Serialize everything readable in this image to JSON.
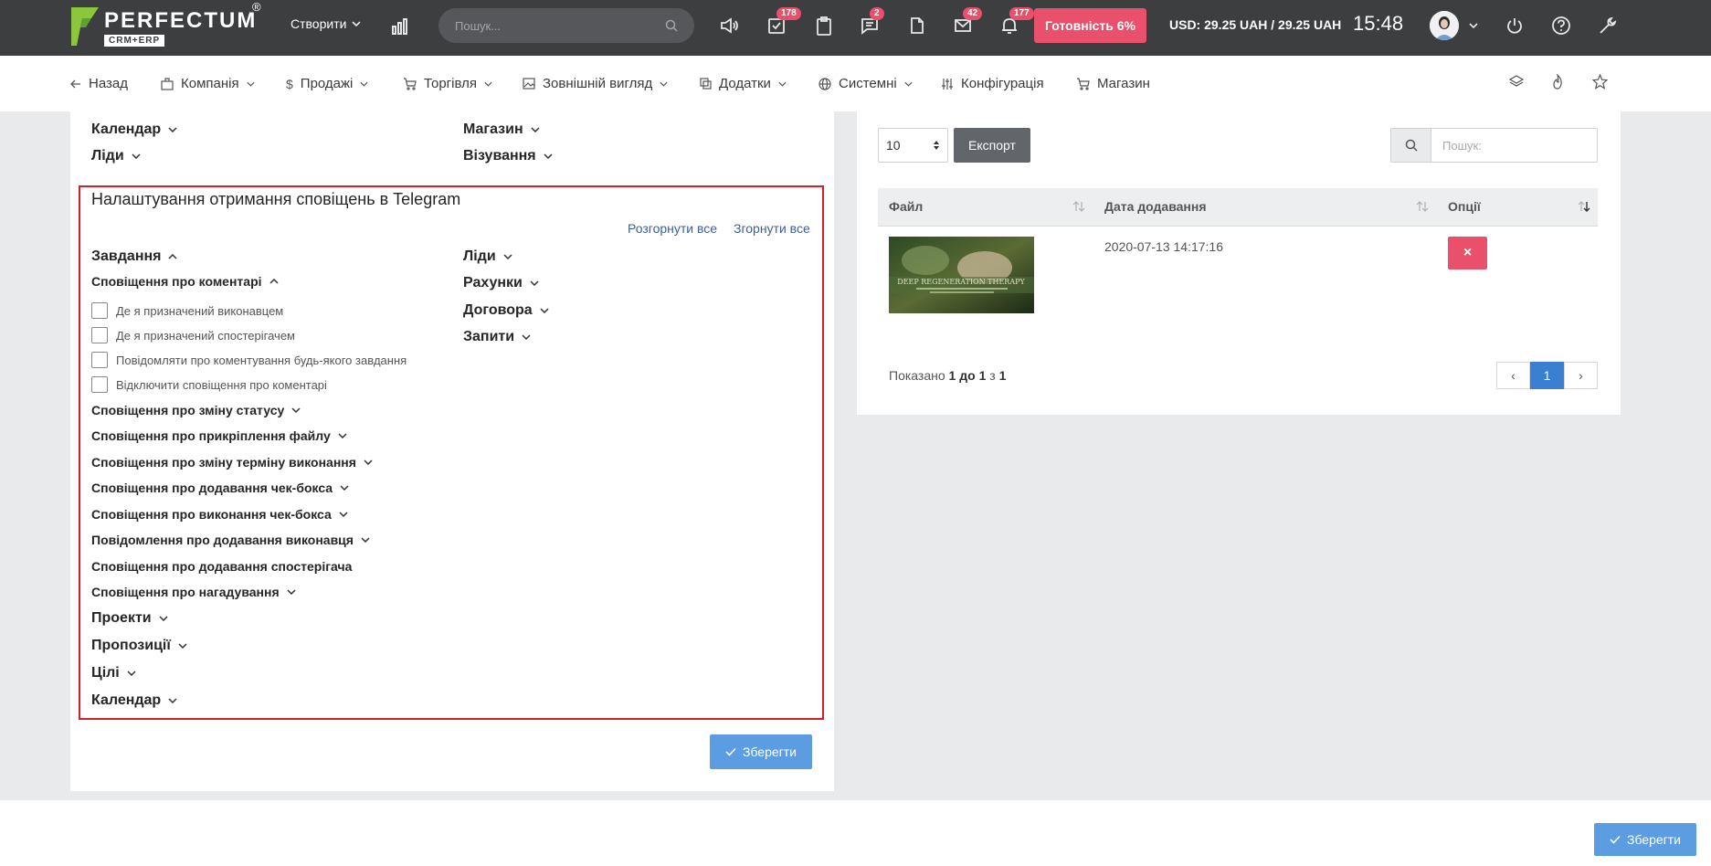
{
  "topbar": {
    "brand": "PERFECTUM",
    "brand_reg": "®",
    "brand_sub": "CRM+ERP",
    "create_label": "Створити",
    "search_placeholder": "Пошук...",
    "badges": {
      "tasks": "178",
      "chat": "2",
      "mail": "42",
      "notifications": "177"
    },
    "ready_label": "Готовність 6%",
    "rate_text": "USD: 29.25 UAH / 29.25 UAH",
    "time": "15:48"
  },
  "nav": {
    "items": [
      "Назад",
      "Компанія",
      "Продажі",
      "Торгівля",
      "Зовнішній вигляд",
      "Додатки",
      "Системні",
      "Конфігурація",
      "Магазин"
    ]
  },
  "left": {
    "top_sections": {
      "calendar": "Календар",
      "shop": "Магазин",
      "leads": "Ліди",
      "visa": "Візування"
    },
    "telegram_title": "Налаштування отримання сповіщень в Telegram",
    "expand_all": "Розгорнути все",
    "collapse_all": "Згорнути все",
    "col1": {
      "tasks": "Завдання",
      "comments": "Сповіщення про коментарі",
      "checkboxes": [
        "Де я призначений виконавцем",
        "Де я призначений спостерігачем",
        "Повідомляти про коментування будь-якого завдання",
        "Відключити сповіщення про коментарі"
      ],
      "subs": [
        "Сповіщення про зміну статусу",
        "Сповіщення про прикріплення файлу",
        "Сповіщення про зміну терміну виконання",
        "Сповіщення про додавання чек-бокса",
        "Сповіщення про виконання чек-бокса",
        "Повідомлення про додавання виконавця",
        "Сповіщення про додавання спостерігача",
        "Сповіщення про нагадування"
      ],
      "sections": [
        "Проекти",
        "Пропозиції",
        "Цілі",
        "Календар"
      ]
    },
    "col2": [
      "Ліди",
      "Рахунки",
      "Договора",
      "Запити"
    ],
    "save_label": "Зберегти"
  },
  "right": {
    "per_page": "10",
    "export_label": "Експорт",
    "search_placeholder": "Пошук:",
    "columns": [
      "Файл",
      "Дата додавання",
      "Опції"
    ],
    "rows": [
      {
        "date": "2020-07-13 14:17:16",
        "thumb_caption": "DEEP REGENERATION THERAPY"
      }
    ],
    "delete_label": "×",
    "shown": {
      "prefix": "Показано",
      "from": "1",
      "mid1": "до",
      "to": "1",
      "mid2": "з",
      "total": "1"
    },
    "pager": {
      "prev": "‹",
      "current": "1",
      "next": "›"
    }
  },
  "footer": {
    "save_label": "Зберегти"
  },
  "colors": {
    "accent_red": "#e8506b",
    "primary_blue": "#5b9de0",
    "topbar_bg": "#3d3e40",
    "highlight_border": "#d21f2a"
  }
}
